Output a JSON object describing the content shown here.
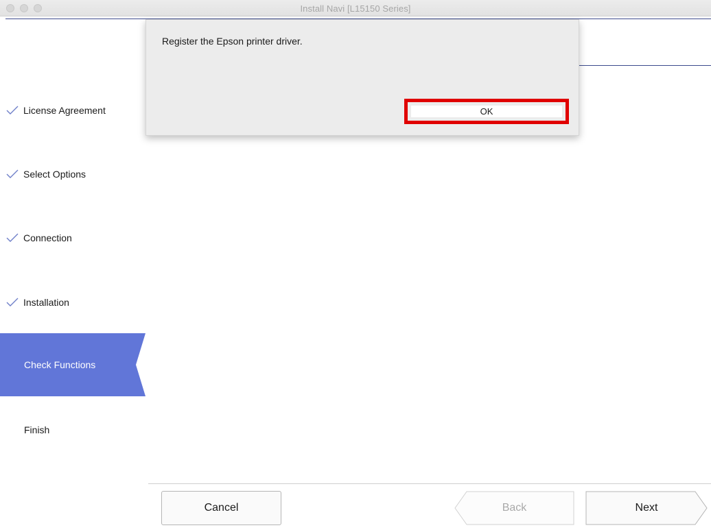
{
  "window": {
    "title": "Install Navi [L15150 Series]"
  },
  "sidebar": {
    "steps": [
      {
        "label": "License Agreement",
        "state": "done"
      },
      {
        "label": "Select Options",
        "state": "done"
      },
      {
        "label": "Connection",
        "state": "done"
      },
      {
        "label": "Installation",
        "state": "done"
      },
      {
        "label": "Check Functions",
        "state": "active"
      },
      {
        "label": "Finish",
        "state": "pending"
      }
    ],
    "active_color": "#6176d8"
  },
  "dialog": {
    "message": "Register the Epson printer driver.",
    "ok_label": "OK",
    "highlight_color": "#e00000"
  },
  "footer": {
    "cancel_label": "Cancel",
    "back_label": "Back",
    "next_label": "Next"
  }
}
